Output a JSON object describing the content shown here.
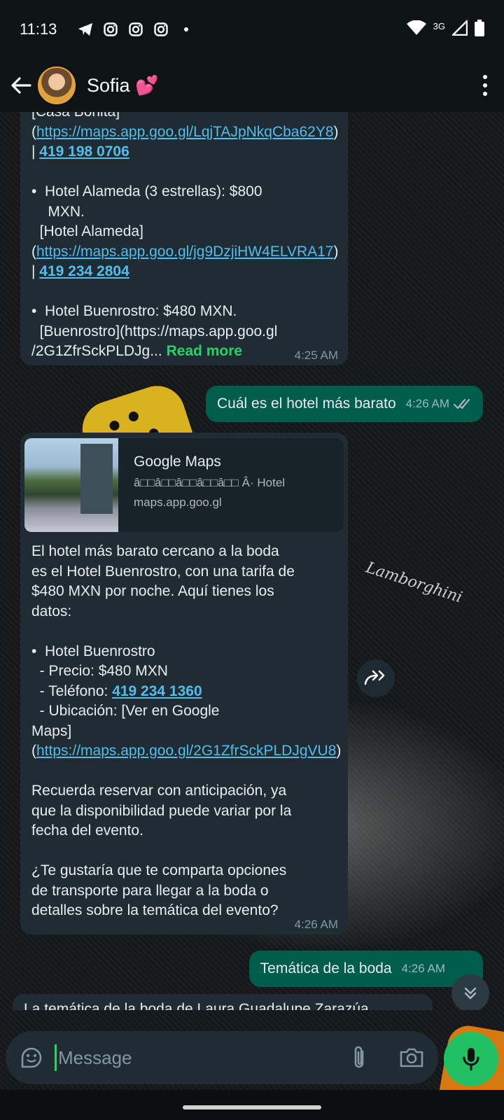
{
  "status_bar": {
    "time": "11:13",
    "network": "3G",
    "icons": [
      "telegram-icon",
      "instagram-icon",
      "instagram-icon",
      "instagram-icon",
      "dot-icon",
      "wifi-icon",
      "signal-icon",
      "battery-icon"
    ]
  },
  "header": {
    "contact_name": "Sofia 💕"
  },
  "messages": {
    "m1": {
      "line1": "[Casa Bonita](",
      "link1": "https://maps.app.goo.gl/LqjTAJpNkqCba62Y8",
      "sep1": ") | ",
      "phone1": "419 198 0706",
      "item2": "•  Hotel Alameda (3 estrellas): $800\n    MXN.\n  [Hotel Alameda](",
      "link2": "https://maps.app.goo.gl/jg9DzjiHW4ELVRA17",
      "sep2": ") | ",
      "phone2": "419 234 2804",
      "item3": "•  Hotel Buenrostro: $480 MXN.\n  [Buenrostro](https://maps.app.goo.gl\n/2G1ZfrSckPLDJg... ",
      "read_more": "Read more",
      "time": "4:25 AM"
    },
    "m2": {
      "text": "Cuál es el hotel más barato",
      "time": "4:26 AM"
    },
    "m3": {
      "preview_title": "Google Maps",
      "preview_desc": "â□□â□□â□□â□□â□□ Â· Hotel",
      "preview_domain": "maps.app.goo.gl",
      "para1": "El hotel más barato cercano a la boda\nes el Hotel Buenrostro, con una tarifa de\n$480 MXN por noche. Aquí tienes los\ndatos:",
      "item_title": "•  Hotel Buenrostro",
      "price": "  - Precio: $480 MXN",
      "phone_label": "  - Teléfono: ",
      "phone": "419 234 1360",
      "location_label": "  - Ubicación: [Ver en Google\nMaps](",
      "link": "https://maps.app.goo.gl/2G1ZfrSckPLDJgVU8",
      "link_end": ")",
      "para2": "Recuerda reservar con anticipación, ya\nque la disponibilidad puede variar por la\nfecha del evento.",
      "para3": "¿Te gustaría que te comparta opciones\nde transporte para llegar a la boda o\ndetalles sobre la temática del evento?",
      "time": "4:26 AM"
    },
    "m4": {
      "text": "Temática de la boda",
      "time": "4:26 AM"
    },
    "m5": {
      "text_partial": "La temática de la boda de Laura Guadalupe Zarazúa"
    }
  },
  "composer": {
    "placeholder": "Message"
  }
}
